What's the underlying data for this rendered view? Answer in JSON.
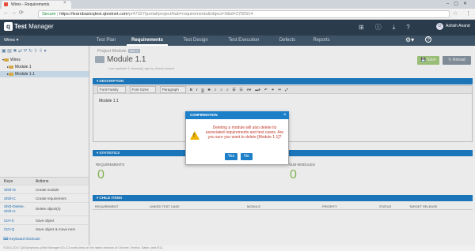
{
  "browser": {
    "tab_title": "Wires - Requirements",
    "secure_label": "Secure",
    "url_base": "https://learnbasicqtest.qtestnet.com",
    "url_path": "/p/47327/portal/project#tab=requirements&object=0&id=2755514"
  },
  "app": {
    "brand_q": "q",
    "brand_test": "Test",
    "brand_manager": "Manager",
    "user_name": "Ashish Anand"
  },
  "nav": {
    "project": "Wires",
    "tabs": [
      "Test Plan",
      "Requirements",
      "Test Design",
      "Test Execution",
      "Defects",
      "Reports"
    ]
  },
  "tree": {
    "root": "Wires",
    "items": [
      "Module 1",
      "Module 1.1"
    ]
  },
  "keys": {
    "header_keys": "Keys",
    "header_actions": "Actions",
    "rows": [
      {
        "key": "Shift+D",
        "action": "Create module"
      },
      {
        "key": "Shift+C",
        "action": "Create requirement"
      },
      {
        "key": "Shift+Delete, Shift+X",
        "action": "Delete object(s)"
      },
      {
        "key": "Ctrl+S",
        "action": "Save object"
      },
      {
        "key": "Ctrl+Q",
        "action": "Save object & move next"
      }
    ],
    "shortcuts_link": "Keyboard shortcuts"
  },
  "footer": "©2011-2017 QASymphony   qTest Manager 8.5.3.2 works best on the latest versions of Chrome, Firefox, Safari, and IE11",
  "main": {
    "project_module": "Project Module",
    "module_badge": "MD-3",
    "title": "Module 1.1",
    "updated": "Last updated 1 minute(s) ago by Ashish Anand",
    "save": "Save",
    "reload": "Reload",
    "description_header": "DESCRIPTION",
    "editor": {
      "font_family": "Font Family",
      "font_sizes": "Font Sizes",
      "paragraph": "Paragraph",
      "bold": "B",
      "italic": "I",
      "underline": "U",
      "strike": "S",
      "content": "Module 1.1"
    },
    "statistics_header": "STATISTICS",
    "stat_requirements_label": "REQUIREMENTS",
    "stat_requirements_value": "0",
    "stat_modules_label": "SUB-MODULES",
    "stat_modules_value": "0",
    "children_header": "CHILD ITEMS",
    "child_columns": [
      "REQUIREMENT",
      "LINKED TEST CASE",
      "MODULE",
      "PRIORITY",
      "STATUS",
      "TARGET RELEASE"
    ]
  },
  "modal": {
    "title": "CONFIRMATION",
    "message": "Deleting a module will also delete its associated requirements and test cases. Are you sure you want to delete [Module 1.1]?",
    "yes": "Yes",
    "no": "No"
  },
  "colors": {
    "header_bg": "#2a3b4c",
    "nav_bg": "#3e5366",
    "accent_blue": "#1e7fc9",
    "save_green": "#a8cf82",
    "stat_green": "#8fc35a",
    "warning": "#f0b400"
  }
}
